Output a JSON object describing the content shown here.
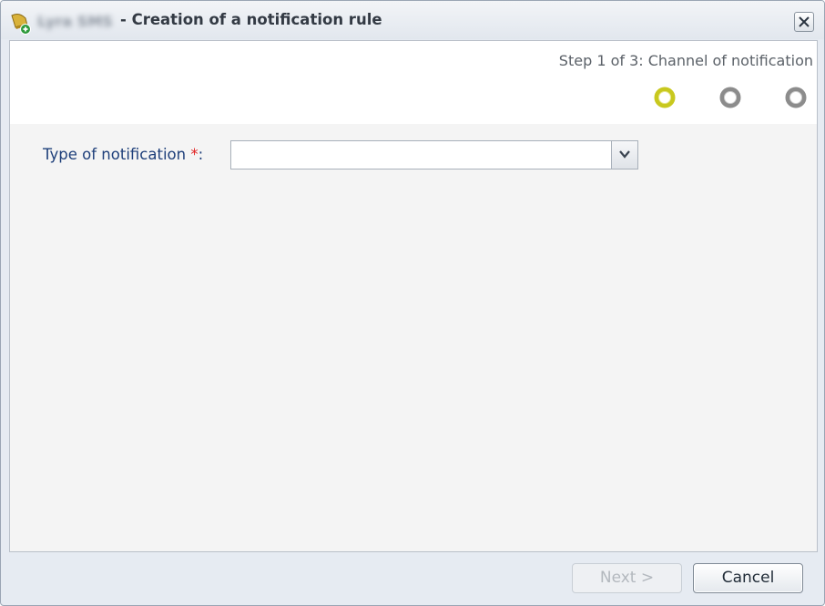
{
  "dialog": {
    "app_name": "Lyra SMS",
    "title": "- Creation of a notification rule",
    "icon": "bell-add-icon",
    "close_icon": "close-icon"
  },
  "wizard": {
    "step_text": "Step 1 of 3: Channel of notification",
    "total_steps": 3,
    "current_step": 1,
    "active_color": "#c8c81e",
    "inactive_color": "#8c8c8c"
  },
  "form": {
    "type_label": "Type of notification",
    "required_mark": "*",
    "colon": ":",
    "type_value": ""
  },
  "buttons": {
    "next_label": "Next >",
    "cancel_label": "Cancel"
  }
}
